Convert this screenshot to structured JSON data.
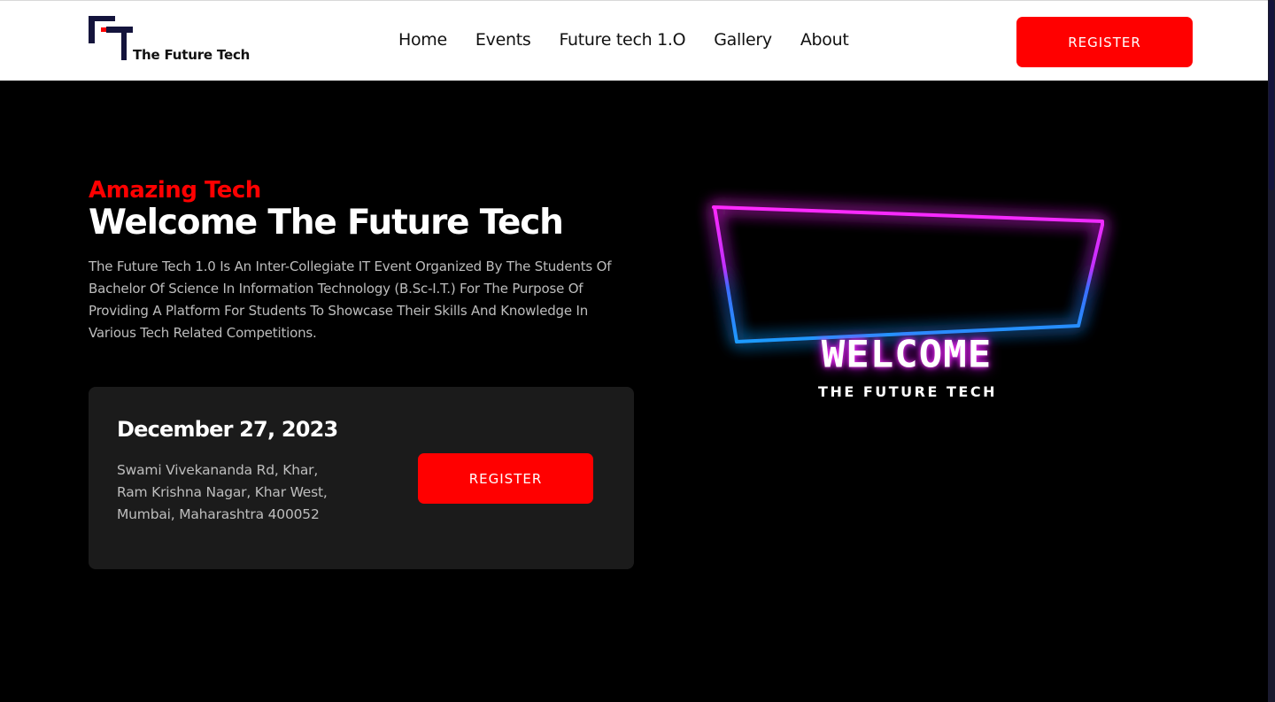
{
  "brand": {
    "name": "The Future Tech"
  },
  "nav": {
    "items": [
      "Home",
      "Events",
      "Future tech 1.O",
      "Gallery",
      "About"
    ]
  },
  "header": {
    "register_label": "REGISTER"
  },
  "hero": {
    "eyebrow": "Amazing Tech",
    "headline": "Welcome The Future Tech",
    "description": "The Future Tech 1.0 Is An Inter-Collegiate IT Event Organized By The Students Of Bachelor Of Science In Information Technology (B.Sc-I.T.) For The Purpose Of Providing A Platform For Students To Showcase Their Skills And Knowledge In Various Tech Related Competitions."
  },
  "event_card": {
    "date": "December 27, 2023",
    "address_lines": [
      "Swami Vivekananda Rd, Khar,",
      "Ram Krishna Nagar, Khar West,",
      "Mumbai, Maharashtra 400052"
    ],
    "register_label": "REGISTER"
  },
  "banner": {
    "title": "WELCOME",
    "subtitle": "THE FUTURE TECH"
  },
  "colors": {
    "accent": "#ff0000",
    "logo_navy": "#14143c",
    "neon_pink": "#ff2bff",
    "neon_blue": "#1e6bff"
  }
}
